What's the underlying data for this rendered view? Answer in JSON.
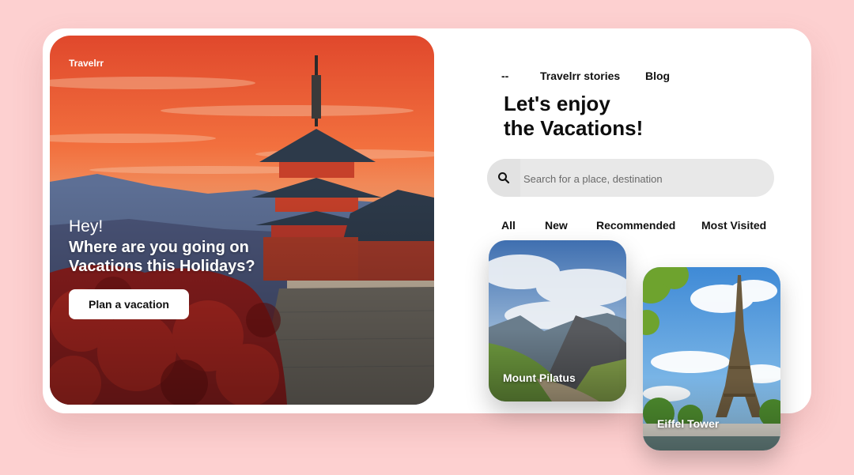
{
  "hero": {
    "brand": "Travelrr",
    "greeting": "Hey!",
    "headline": "Where are you going on Vacations this Holidays?",
    "cta_label": "Plan a vacation"
  },
  "nav": {
    "items": [
      "--",
      "Travelrr stories",
      "Blog"
    ]
  },
  "main": {
    "title_line1": "Let's enjoy",
    "title_line2": "the Vacations!",
    "search_placeholder": "Search for a place, destination",
    "search_icon": "search-icon",
    "tabs": [
      "All",
      "New",
      "Recommended",
      "Most Visited"
    ]
  },
  "destinations": [
    {
      "name": "Mount Pilatus"
    },
    {
      "name": "Eiffel Tower"
    }
  ],
  "colors": {
    "page_background": "#fdd0d0",
    "card_background": "#ffffff",
    "search_background": "#e8e8e8"
  }
}
